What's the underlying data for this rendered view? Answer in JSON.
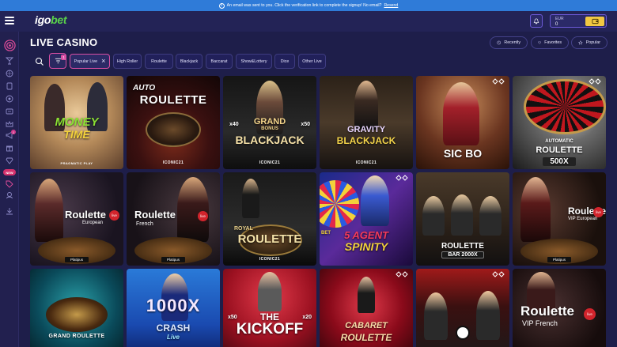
{
  "notice": {
    "text": "An email was sent to you. Click the verification link to complete the signup! No email?",
    "link": "Resend"
  },
  "brand": {
    "logo_part1": "igo",
    "logo_part2": "bet"
  },
  "wallet": {
    "currency": "EUR",
    "balance": "0"
  },
  "page": {
    "title": "LIVE CASINO"
  },
  "quick_links": {
    "recently": "Recently",
    "favorites": "Favorites",
    "popular": "Popular"
  },
  "filter": {
    "count": "1"
  },
  "sidebar": {
    "badge_count": "1",
    "new_label": "NEW"
  },
  "chips": [
    {
      "label": "Popular Live",
      "active": true
    },
    {
      "label": "High Roller"
    },
    {
      "label": "Roulette"
    },
    {
      "label": "Blackjack"
    },
    {
      "label": "Baccarat"
    },
    {
      "label": "Show&Lottery"
    },
    {
      "label": "Dice"
    },
    {
      "label": "Other Live"
    }
  ],
  "games": [
    {
      "line1": "MONEY",
      "line2": "TIME",
      "brand": "PRAGMATIC PLAY"
    },
    {
      "line1": "AUTO",
      "line2": "ROULETTE",
      "brand": "ICONIC21"
    },
    {
      "line1": "GRAND",
      "line2": "BLACKJACK",
      "extra": "BONUS",
      "left": "x40",
      "right": "x50",
      "brand": "ICONIC21"
    },
    {
      "line1": "GRAVITY",
      "line2": "BLACKJACK",
      "brand": "ICONIC21"
    },
    {
      "line1": "SIC BO"
    },
    {
      "line1": "AUTOMATIC",
      "line2": "ROULETTE",
      "extra": "500X"
    },
    {
      "line1": "Roulette",
      "line2": "European",
      "live": "live",
      "provider": "Platipus"
    },
    {
      "line1": "Roulette",
      "line2": "French",
      "live": "live",
      "provider": "Platipus"
    },
    {
      "line1": "ROYAL",
      "line2": "ROULETTE",
      "brand": "ICONIC21"
    },
    {
      "line1": "5 AGENT",
      "line2": "SPINITY",
      "extra": "BET"
    },
    {
      "line1": "ROULETTE",
      "line2": "BAR 2000X"
    },
    {
      "line1": "Roulette",
      "line2": "VIP European",
      "live": "live",
      "provider": "Platipus"
    },
    {
      "line1": "GRAND ROULETTE"
    },
    {
      "line1": "1000X",
      "line2": "CRASH",
      "extra": "Live"
    },
    {
      "line1": "THE",
      "line2": "KICKOFF",
      "left": "x50",
      "right": "x20"
    },
    {
      "line1": "CABARET",
      "line2": "ROULETTE"
    },
    {
      "line1": ""
    },
    {
      "line1": "Roulette",
      "line2": "VIP French",
      "live": "live"
    }
  ]
}
